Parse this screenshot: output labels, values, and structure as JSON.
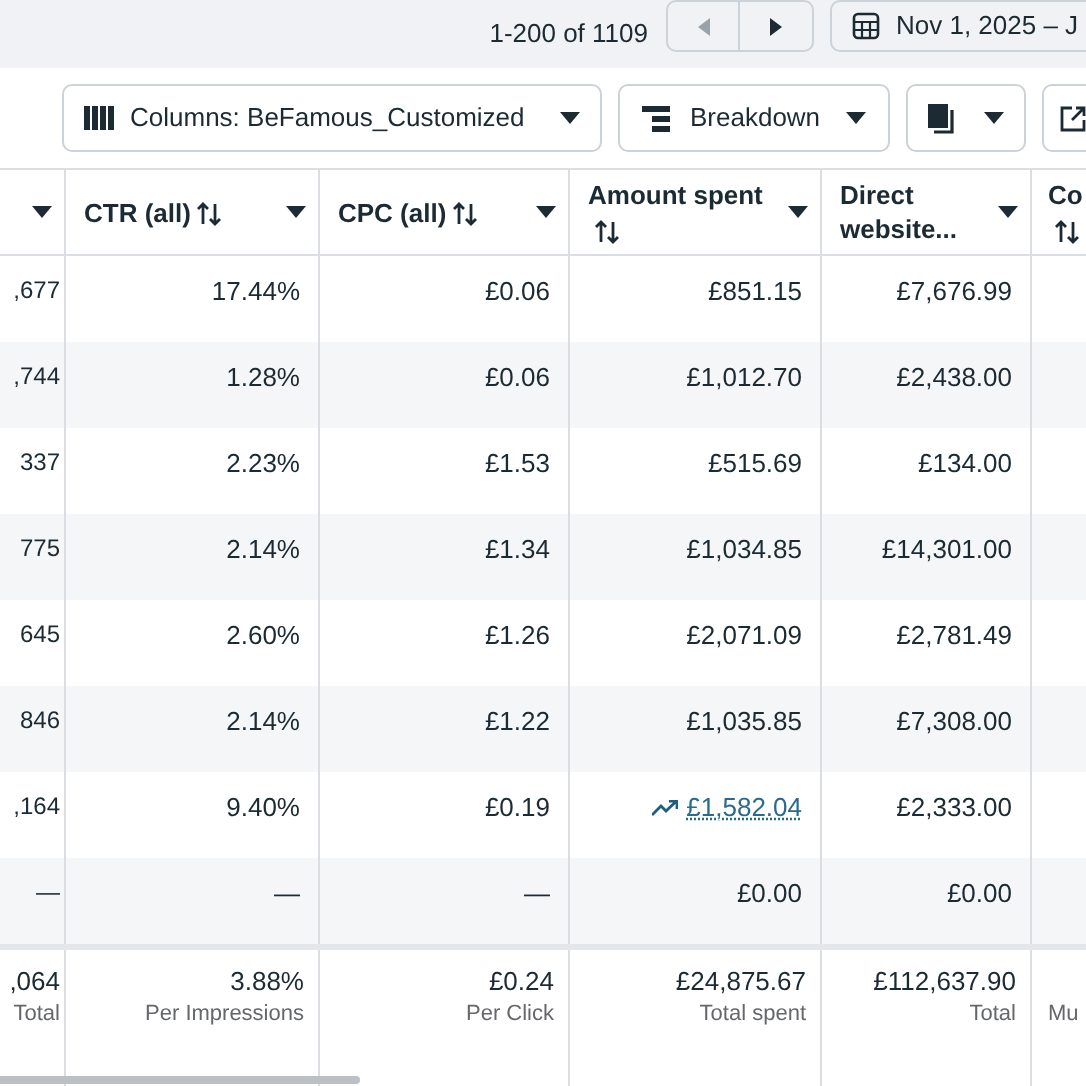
{
  "pagination": {
    "range": "1-200 of 1109",
    "prev_disabled": true,
    "next_disabled": false
  },
  "date_range": {
    "label": "Nov 1, 2025 – J"
  },
  "toolbar": {
    "columns_button": "Columns: BeFamous_Customized",
    "breakdown_button": "Breakdown"
  },
  "table": {
    "columns": [
      {
        "sortable": false
      },
      {
        "label": "CTR (all)",
        "sortable": true
      },
      {
        "label": "CPC (all)",
        "sortable": true
      },
      {
        "label": "Amount spent",
        "sortable": true
      },
      {
        "label": "Direct website...",
        "sortable": false
      },
      {
        "label": "Co",
        "sortable": true
      }
    ],
    "rows": [
      {
        "cells": [
          {
            "text": ",677"
          },
          {
            "text": "17.44%"
          },
          {
            "text": "£0.06"
          },
          {
            "text": "£851.15"
          },
          {
            "text": "£7,676.99"
          }
        ]
      },
      {
        "cells": [
          {
            "text": ",744"
          },
          {
            "text": "1.28%"
          },
          {
            "text": "£0.06"
          },
          {
            "text": "£1,012.70"
          },
          {
            "text": "£2,438.00"
          }
        ]
      },
      {
        "cells": [
          {
            "text": "337"
          },
          {
            "text": "2.23%"
          },
          {
            "text": "£1.53"
          },
          {
            "text": "£515.69"
          },
          {
            "text": "£134.00"
          }
        ]
      },
      {
        "cells": [
          {
            "text": "775"
          },
          {
            "text": "2.14%"
          },
          {
            "text": "£1.34"
          },
          {
            "text": "£1,034.85"
          },
          {
            "text": "£14,301.00"
          }
        ]
      },
      {
        "cells": [
          {
            "text": "645"
          },
          {
            "text": "2.60%"
          },
          {
            "text": "£1.26"
          },
          {
            "text": "£2,071.09"
          },
          {
            "text": "£2,781.49"
          }
        ]
      },
      {
        "cells": [
          {
            "text": "846"
          },
          {
            "text": "2.14%"
          },
          {
            "text": "£1.22"
          },
          {
            "text": "£1,035.85"
          },
          {
            "text": "£7,308.00"
          }
        ]
      },
      {
        "cells": [
          {
            "text": ",164"
          },
          {
            "text": "9.40%"
          },
          {
            "text": "£0.19"
          },
          {
            "text": "£1,582.04",
            "kind": "link"
          },
          {
            "text": "£2,333.00"
          }
        ]
      },
      {
        "cells": [
          {
            "text": "—"
          },
          {
            "text": "—"
          },
          {
            "text": "—"
          },
          {
            "text": "£0.00"
          },
          {
            "text": "£0.00"
          }
        ]
      }
    ],
    "totals": [
      {
        "value": ",064",
        "label": "Total"
      },
      {
        "value": "3.88%",
        "label": "Per Impressions"
      },
      {
        "value": "£0.24",
        "label": "Per Click"
      },
      {
        "value": "£24,875.67",
        "label": "Total spent"
      },
      {
        "value": "£112,637.90",
        "label": "Total"
      },
      {
        "label": "Mu"
      }
    ]
  }
}
